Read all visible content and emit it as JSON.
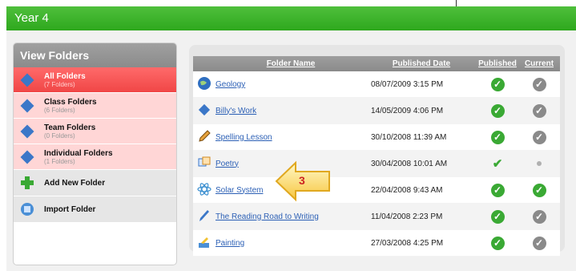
{
  "title": "Year 4",
  "view_folders": {
    "heading": "View Folders",
    "items": [
      {
        "label": "All Folders",
        "count": "(7 Folders)",
        "icon": "all-folders-icon",
        "active": true
      },
      {
        "label": "Class Folders",
        "count": "(6 Folders)",
        "icon": "class-folders-icon",
        "active": false
      },
      {
        "label": "Team Folders",
        "count": "(0 Folders)",
        "icon": "team-folders-icon",
        "active": false
      },
      {
        "label": "Individual Folders",
        "count": "(1 Folders)",
        "icon": "individual-folders-icon",
        "active": false
      }
    ],
    "actions": [
      {
        "label": "Add New Folder",
        "icon": "add-folder-icon"
      },
      {
        "label": "Import Folder",
        "icon": "import-folder-icon"
      }
    ]
  },
  "table": {
    "columns": [
      "Folder Name",
      "Published Date",
      "Published",
      "Current"
    ],
    "rows": [
      {
        "name": "Geology",
        "date": "08/07/2009 3:15 PM",
        "icon": "globe-icon",
        "published": "check",
        "current": "grey-check"
      },
      {
        "name": "Billy's Work",
        "date": "14/05/2009 4:06 PM",
        "icon": "diamond-icon",
        "published": "check",
        "current": "grey-check"
      },
      {
        "name": "Spelling Lesson",
        "date": "30/10/2008 11:39 AM",
        "icon": "pencil-icon",
        "published": "check",
        "current": "grey-check"
      },
      {
        "name": "Poetry",
        "date": "30/04/2008 10:01 AM",
        "icon": "blocks-icon",
        "published": "plain-check",
        "current": "dot"
      },
      {
        "name": "Solar System",
        "date": "22/04/2008 9:43 AM",
        "icon": "atom-icon",
        "published": "check",
        "current": "check"
      },
      {
        "name": "The Reading Road to Writing",
        "date": "11/04/2008 2:23 PM",
        "icon": "pen-icon",
        "published": "check",
        "current": "grey-check"
      },
      {
        "name": "Painting",
        "date": "27/03/2008 4:25 PM",
        "icon": "paint-icon",
        "published": "check",
        "current": "grey-check"
      }
    ]
  },
  "callout": {
    "number": "3"
  },
  "colors": {
    "titlebar": "#2ea81d",
    "active_nav": "#f04646",
    "nav_bg": "#ffd6d6",
    "link": "#2b5fb5",
    "check_green": "#3aa934",
    "check_grey": "#8a8a8a"
  }
}
